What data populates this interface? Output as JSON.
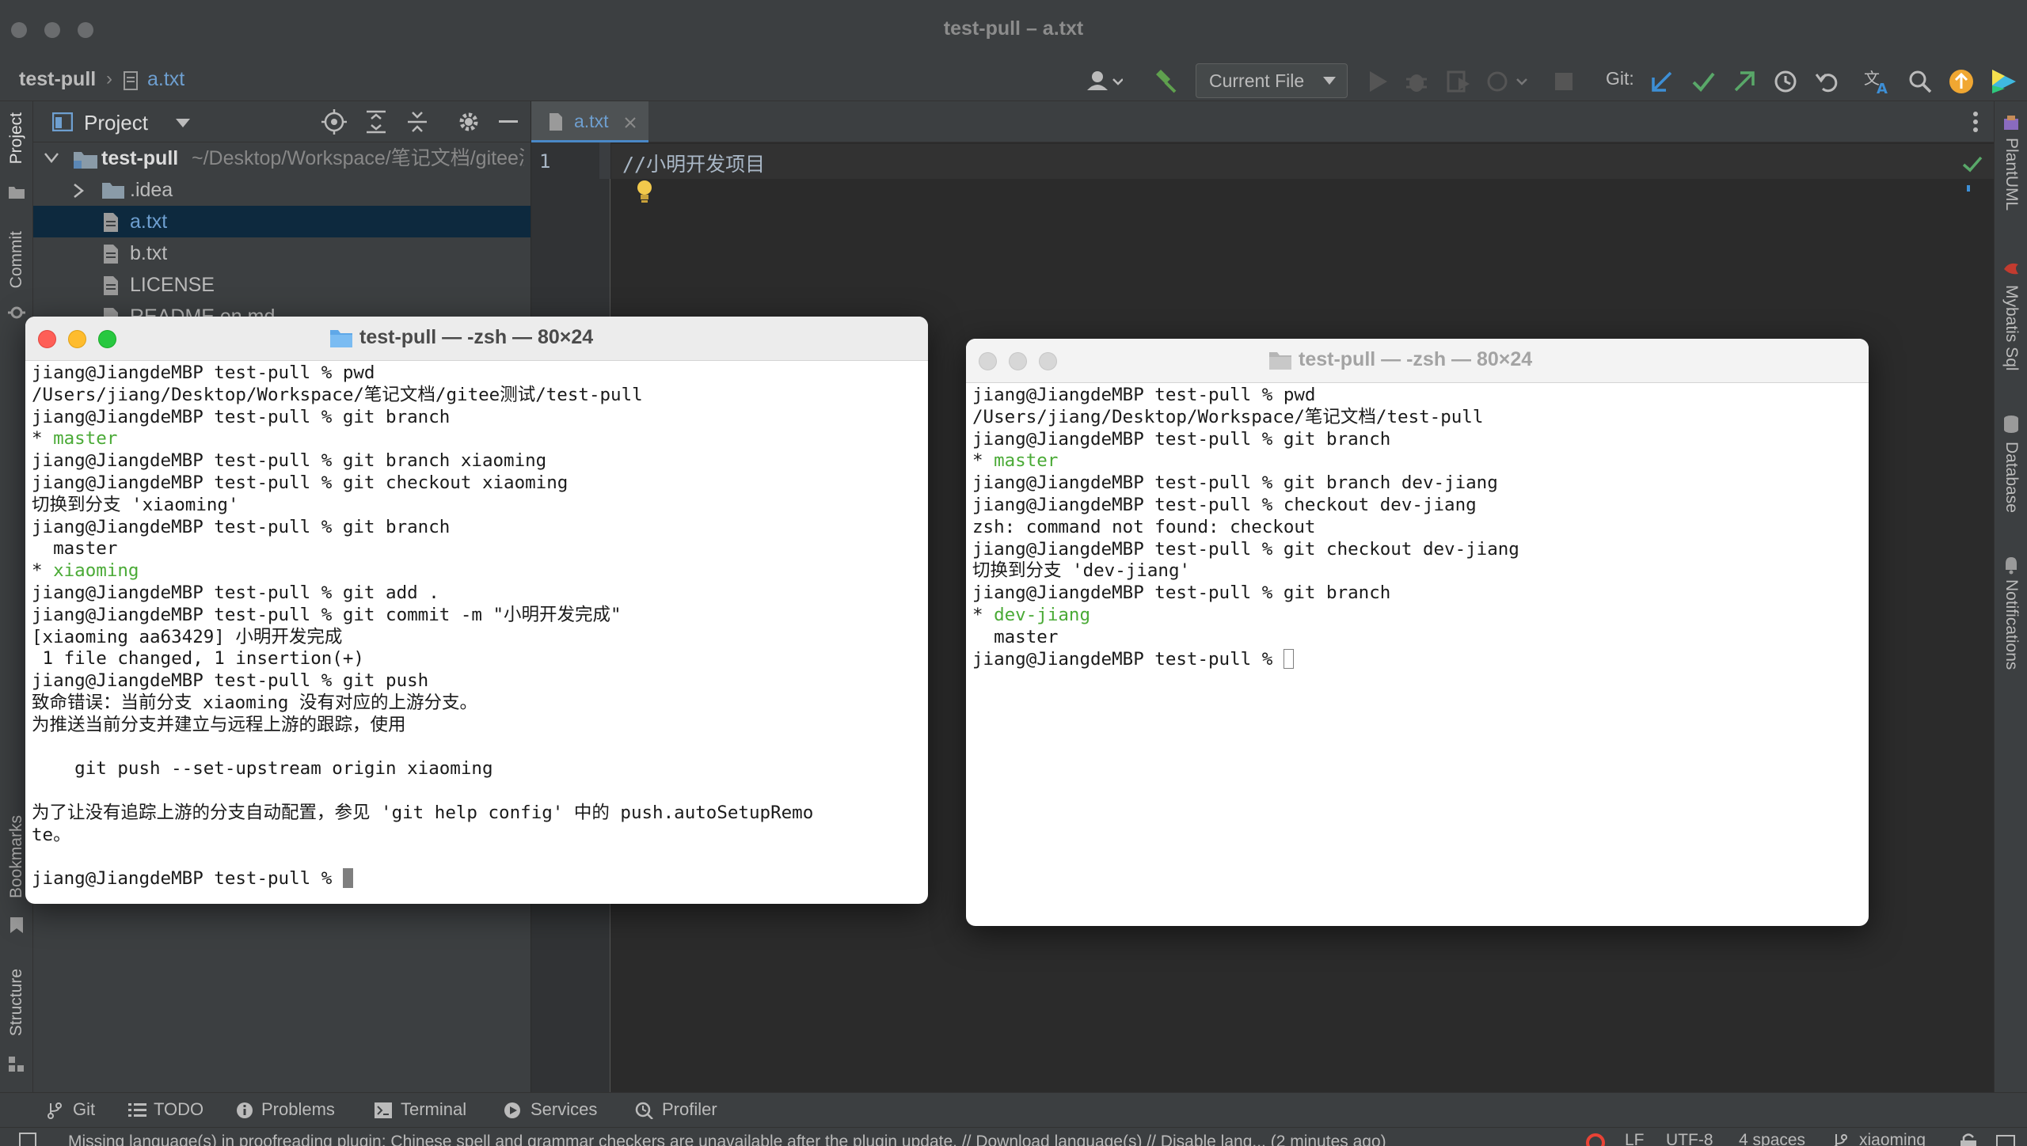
{
  "window": {
    "title": "test-pull – a.txt"
  },
  "breadcrumb": {
    "project": "test-pull",
    "file": "a.txt"
  },
  "toolbar": {
    "run_config": "Current File",
    "git_label": "Git:"
  },
  "project_panel": {
    "title": "Project",
    "root_name": "test-pull",
    "root_path": " ~/Desktop/Workspace/笔记文档/gitee测试/test-pull",
    "items": [
      ".idea",
      "a.txt",
      "b.txt",
      "LICENSE",
      "README.en.md"
    ]
  },
  "editor": {
    "tab": "a.txt",
    "line_number": "1",
    "line_text": "//小明开发项目"
  },
  "left_strip": {
    "project": "Project",
    "commit": "Commit",
    "bookmarks": "Bookmarks",
    "structure": "Structure"
  },
  "right_strip": {
    "plantuml": "PlantUML",
    "mybatis": "Mybatis Sql",
    "database": "Database",
    "notifications": "Notifications"
  },
  "bottom_tools": [
    "Git",
    "TODO",
    "Problems",
    "Terminal",
    "Services",
    "Profiler"
  ],
  "status": {
    "message": "Missing language(s) in proofreading plugin: Chinese spell and grammar checkers are unavailable after the plugin update. // Download language(s) // Disable lang... (2 minutes ago)",
    "line_sep": "LF",
    "encoding": "UTF-8",
    "indent": "4 spaces",
    "branch": "xiaoming"
  },
  "terminal_left": {
    "title": "test-pull — -zsh — 80×24",
    "lines": [
      {
        "text": "jiang@JiangdeMBP test-pull % pwd"
      },
      {
        "text": "/Users/jiang/Desktop/Workspace/笔记文档/gitee测试/test-pull"
      },
      {
        "text": "jiang@JiangdeMBP test-pull % git branch"
      },
      {
        "text": "* ",
        "green": "master"
      },
      {
        "text": "jiang@JiangdeMBP test-pull % git branch xiaoming"
      },
      {
        "text": "jiang@JiangdeMBP test-pull % git checkout xiaoming"
      },
      {
        "text": "切换到分支 'xiaoming'"
      },
      {
        "text": "jiang@JiangdeMBP test-pull % git branch"
      },
      {
        "text": "  master"
      },
      {
        "text": "* ",
        "green": "xiaoming"
      },
      {
        "text": "jiang@JiangdeMBP test-pull % git add ."
      },
      {
        "text": "jiang@JiangdeMBP test-pull % git commit -m \"小明开发完成\""
      },
      {
        "text": "[xiaoming aa63429] 小明开发完成"
      },
      {
        "text": " 1 file changed, 1 insertion(+)"
      },
      {
        "text": "jiang@JiangdeMBP test-pull % git push"
      },
      {
        "text": "致命错误：当前分支 xiaoming 没有对应的上游分支。"
      },
      {
        "text": "为推送当前分支并建立与远程上游的跟踪，使用"
      },
      {
        "text": ""
      },
      {
        "text": "    git push --set-upstream origin xiaoming"
      },
      {
        "text": ""
      },
      {
        "text": "为了让没有追踪上游的分支自动配置，参见 'git help config' 中的 push.autoSetupRemo"
      },
      {
        "text": "te。"
      },
      {
        "text": ""
      },
      {
        "text": "jiang@JiangdeMBP test-pull % "
      }
    ]
  },
  "terminal_right": {
    "title": "test-pull — -zsh — 80×24",
    "lines": [
      {
        "text": "jiang@JiangdeMBP test-pull % pwd"
      },
      {
        "text": "/Users/jiang/Desktop/Workspace/笔记文档/test-pull"
      },
      {
        "text": "jiang@JiangdeMBP test-pull % git branch"
      },
      {
        "text": "* ",
        "green": "master"
      },
      {
        "text": "jiang@JiangdeMBP test-pull % git branch dev-jiang"
      },
      {
        "text": "jiang@JiangdeMBP test-pull % checkout dev-jiang"
      },
      {
        "text": "zsh: command not found: checkout"
      },
      {
        "text": "jiang@JiangdeMBP test-pull % git checkout dev-jiang"
      },
      {
        "text": "切换到分支 'dev-jiang'"
      },
      {
        "text": "jiang@JiangdeMBP test-pull % git branch"
      },
      {
        "text": "* ",
        "green": "dev-jiang"
      },
      {
        "text": "  master"
      },
      {
        "text": "jiang@JiangdeMBP test-pull % "
      }
    ]
  }
}
